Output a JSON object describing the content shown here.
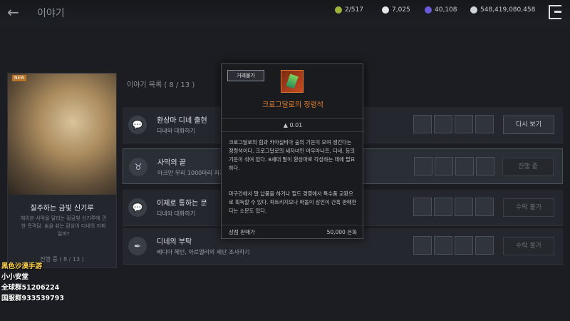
{
  "header": {
    "title": "이야기",
    "resources": [
      "2/517",
      "7,025",
      "40,108",
      "548,419,080,458"
    ]
  },
  "card": {
    "tag": "NEW",
    "name": "질주하는 금빛 신기루",
    "desc": "헤이븐 사막을 달리는 황금빛 신기루에 관한 목격담. 숨을 쉬는 환상이 디네의 지휘일까?",
    "progress": "진행 중 ( 8 / 13 )"
  },
  "list": {
    "header": "이야기 목록 ( 8 / 13 )",
    "rows": [
      {
        "title": "환상마 디네 출현",
        "sub": "디네와 대화하기",
        "button": "다시 보기"
      },
      {
        "title": "사막의 끝",
        "sub": "아크만 무리 1000마리 처치하기",
        "button": "진행 중"
      },
      {
        "title": "이제로 통하는 문",
        "sub": "디네와 대화하기",
        "button": "수락 불가"
      },
      {
        "title": "디네의 부탁",
        "sub": "베디아 헤인, 아르엘리의 세단 조사하기",
        "button": "수락 불가"
      }
    ]
  },
  "tooltip": {
    "tag": "거래불가",
    "name": "크로그달로의 정령석",
    "weight": "0.01",
    "desc": "크로그달로의 힘과 카아실비아 숲의 기운이 모여 생긴다는 정령석이다. 크로그달로의 세자녀인 아우아나프, 디네, 등의 기운이 섞여 있다. 8세대 말이 환상마로 각성하는 데에 필요하다.",
    "desc2": "마구간에서 말 납품을 하거나 필드 경영에서 특수품 교환으로 획득할 수 있다. 파트리지오나 떠돌이 상인이 간혹 판매한다는 소문도 있다.",
    "sell_label": "상점 판매가",
    "sell_value": "50,000 은화"
  },
  "overlay": {
    "line1": "黑色沙漠手游",
    "line2": "小小安堂",
    "line3": "全球群51206224",
    "line4": "国服群933539793"
  },
  "colors": {
    "background": "#1b1d22",
    "accent_orange": "#e8832f"
  }
}
